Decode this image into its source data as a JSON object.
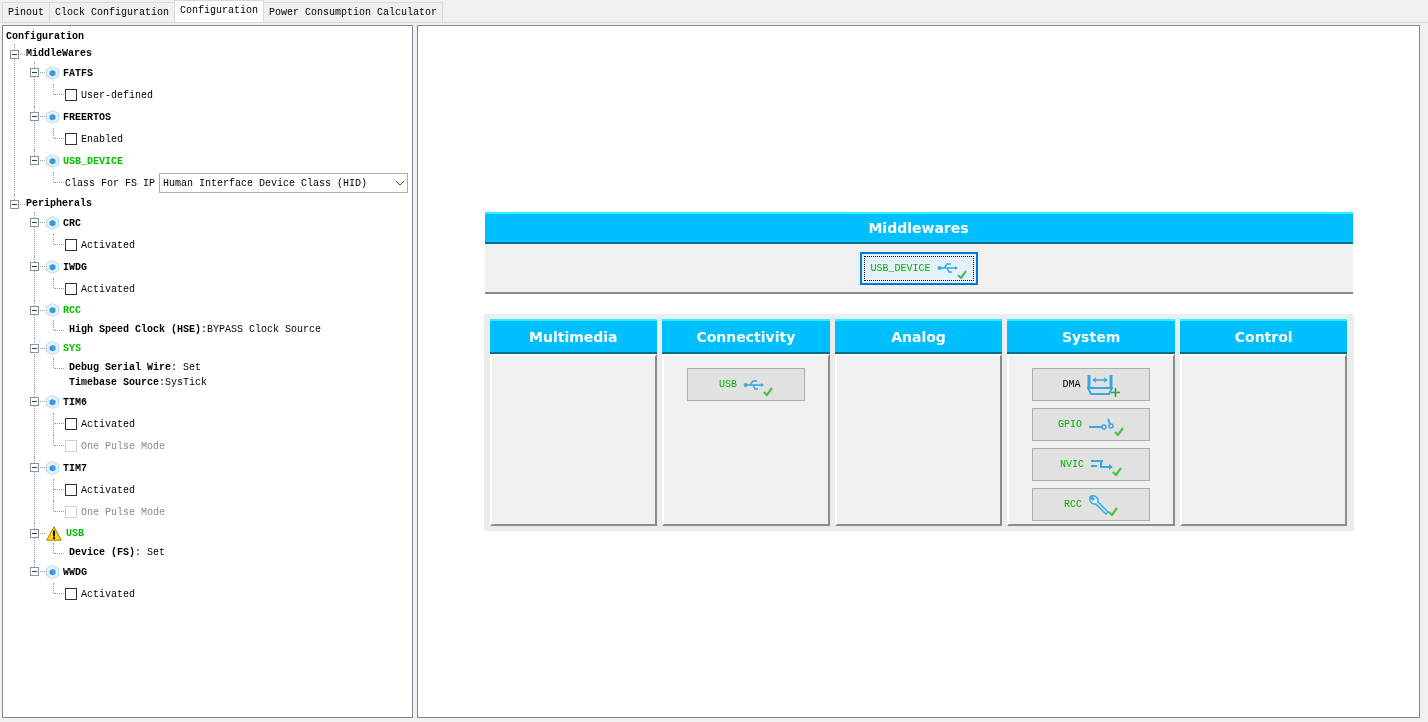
{
  "tabs": [
    {
      "label": "Pinout",
      "selected": false
    },
    {
      "label": "Clock Configuration",
      "selected": false
    },
    {
      "label": "Configuration",
      "selected": true
    },
    {
      "label": "Power Consumption Calculator",
      "selected": false
    }
  ],
  "tree": {
    "title": "Configuration",
    "groups": [
      {
        "label": "MiddleWares",
        "expanded": true,
        "children": [
          {
            "label": "FATFS",
            "configured": false,
            "warning": false,
            "expanded": true,
            "children": [
              {
                "kind": "checkbox",
                "label": "User-defined",
                "checked": false,
                "disabled": false
              }
            ]
          },
          {
            "label": "FREERTOS",
            "configured": false,
            "warning": false,
            "expanded": true,
            "children": [
              {
                "kind": "checkbox",
                "label": "Enabled",
                "checked": false,
                "disabled": false
              }
            ]
          },
          {
            "label": "USB_DEVICE",
            "configured": true,
            "warning": false,
            "expanded": true,
            "children": [
              {
                "kind": "select",
                "label": "Class For FS IP",
                "value": "Human Interface Device Class (HID)"
              }
            ]
          }
        ]
      },
      {
        "label": "Peripherals",
        "expanded": true,
        "children": [
          {
            "label": "CRC",
            "configured": false,
            "warning": false,
            "expanded": true,
            "children": [
              {
                "kind": "checkbox",
                "label": "Activated",
                "checked": false,
                "disabled": false
              }
            ]
          },
          {
            "label": "IWDG",
            "configured": false,
            "warning": false,
            "expanded": true,
            "children": [
              {
                "kind": "checkbox",
                "label": "Activated",
                "checked": false,
                "disabled": false
              }
            ]
          },
          {
            "label": "RCC",
            "configured": true,
            "warning": false,
            "expanded": true,
            "children": [
              {
                "kind": "setting",
                "lines": [
                  "**High Speed Clock (HSE)**:BYPASS Clock Source"
                ]
              }
            ]
          },
          {
            "label": "SYS",
            "configured": true,
            "warning": false,
            "expanded": true,
            "children": [
              {
                "kind": "setting",
                "lines": [
                  "**Debug Serial Wire**: Set",
                  "**Timebase Source**:SysTick"
                ]
              }
            ]
          },
          {
            "label": "TIM6",
            "configured": false,
            "warning": false,
            "expanded": true,
            "children": [
              {
                "kind": "checkbox",
                "label": "Activated",
                "checked": false,
                "disabled": false
              },
              {
                "kind": "checkbox",
                "label": "One Pulse Mode",
                "checked": false,
                "disabled": true
              }
            ]
          },
          {
            "label": "TIM7",
            "configured": false,
            "warning": false,
            "expanded": true,
            "children": [
              {
                "kind": "checkbox",
                "label": "Activated",
                "checked": false,
                "disabled": false
              },
              {
                "kind": "checkbox",
                "label": "One Pulse Mode",
                "checked": false,
                "disabled": true
              }
            ]
          },
          {
            "label": "USB",
            "configured": true,
            "warning": true,
            "expanded": true,
            "children": [
              {
                "kind": "setting",
                "lines": [
                  "**Device (FS)**: Set"
                ]
              }
            ]
          },
          {
            "label": "WWDG",
            "configured": false,
            "warning": false,
            "expanded": true,
            "children": [
              {
                "kind": "checkbox",
                "label": "Activated",
                "checked": false,
                "disabled": false
              }
            ]
          }
        ]
      }
    ]
  },
  "middlewares": {
    "title": "Middlewares",
    "buttons": [
      {
        "label": "USB_DEVICE",
        "kind": "usb",
        "configured": true,
        "selected": true
      }
    ]
  },
  "categories": [
    {
      "title": "Multimedia"
    },
    {
      "title": "Connectivity",
      "buttons": [
        {
          "label": "USB",
          "kind": "usb",
          "configured": true,
          "selected": false
        }
      ]
    },
    {
      "title": "Analog"
    },
    {
      "title": "System",
      "buttons": [
        {
          "label": "DMA",
          "kind": "dma",
          "configured": false,
          "selected": false
        },
        {
          "label": "GPIO",
          "kind": "gpio",
          "configured": true,
          "selected": false
        },
        {
          "label": "NVIC",
          "kind": "nvic",
          "configured": true,
          "selected": false
        },
        {
          "label": "RCC",
          "kind": "rcc",
          "configured": true,
          "selected": false
        }
      ]
    },
    {
      "title": "Control"
    }
  ]
}
